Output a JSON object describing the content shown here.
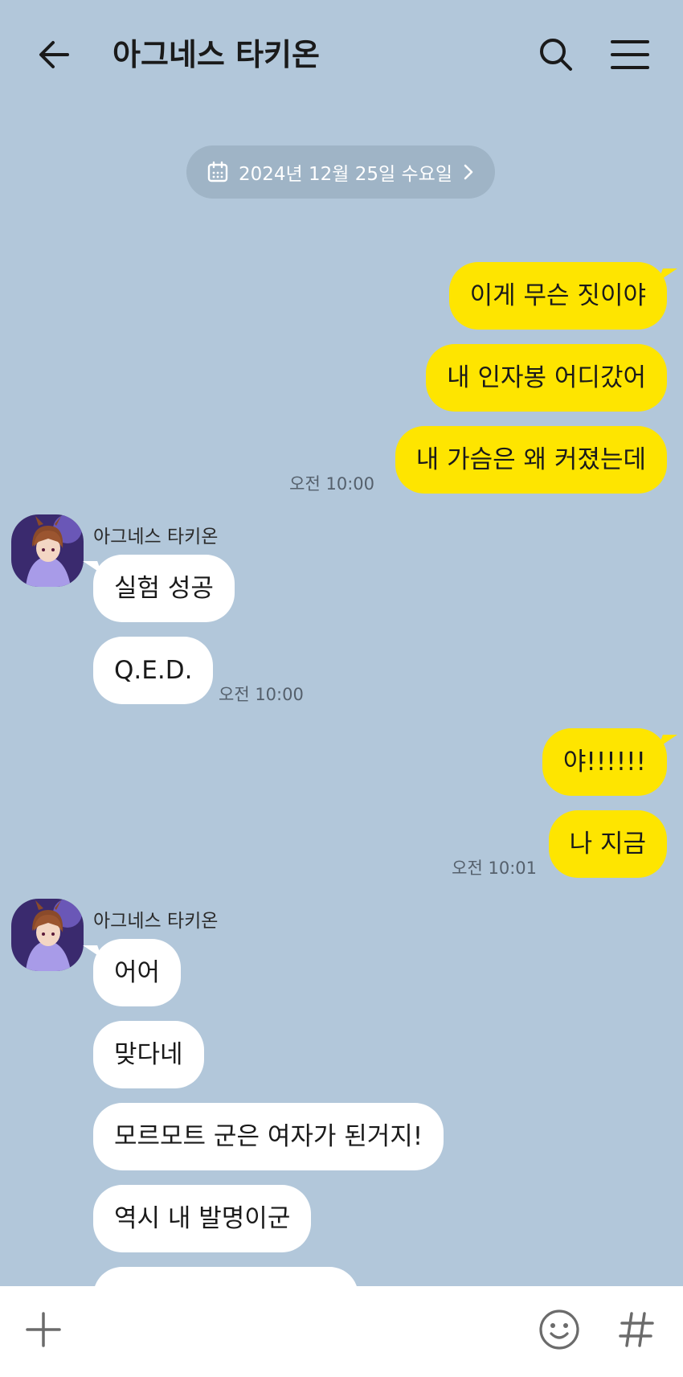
{
  "header": {
    "title": "아그네스 타키온",
    "back_icon": "arrow-left-icon",
    "search_icon": "search-icon",
    "menu_icon": "hamburger-menu-icon"
  },
  "date_divider": {
    "label": "2024년 12월 25일 수요일",
    "icon": "calendar-icon"
  },
  "colors": {
    "background": "#b2c7da",
    "my_bubble": "#fee500",
    "their_bubble": "#ffffff"
  },
  "messages": {
    "group1": {
      "m1": "이게 무슨 짓이야",
      "m2": "내 인자봉 어디갔어",
      "m3": "내 가슴은 왜 커졌는데",
      "time": "오전 10:00"
    },
    "group2": {
      "sender": "아그네스 타키온",
      "m1": "실험 성공",
      "m2": "Q.E.D.",
      "time": "오전 10:00"
    },
    "group3": {
      "m1": "야!!!!!!",
      "m2": "나 지금",
      "time": "오전 10:01"
    },
    "group4": {
      "sender": "아그네스 타키온",
      "m1": "어어",
      "m2": "맞다네",
      "m3": "모르모트 군은 여자가 된거지!",
      "m4": "역시 내 발명이군"
    }
  },
  "input_bar": {
    "plus_icon": "plus-icon",
    "emoji_icon": "emoji-icon",
    "hash_icon": "hash-icon"
  }
}
